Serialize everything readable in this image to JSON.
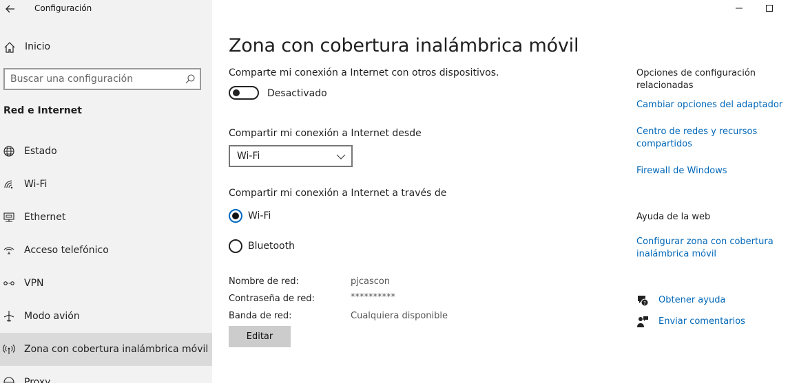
{
  "window": {
    "app_title": "Configuración"
  },
  "sidebar": {
    "home_label": "Inicio",
    "search_placeholder": "Buscar una configuración",
    "section_title": "Red e Internet",
    "items": [
      {
        "label": "Estado",
        "icon": "globe-icon",
        "selected": false
      },
      {
        "label": "Wi-Fi",
        "icon": "wifi-icon",
        "selected": false
      },
      {
        "label": "Ethernet",
        "icon": "ethernet-icon",
        "selected": false
      },
      {
        "label": "Acceso telefónico",
        "icon": "dialup-icon",
        "selected": false
      },
      {
        "label": "VPN",
        "icon": "vpn-icon",
        "selected": false
      },
      {
        "label": "Modo avión",
        "icon": "airplane-icon",
        "selected": false
      },
      {
        "label": "Zona con cobertura inalámbrica móvil",
        "icon": "hotspot-icon",
        "selected": true
      },
      {
        "label": "Proxy",
        "icon": "globe-icon",
        "selected": false
      }
    ]
  },
  "main": {
    "title": "Zona con cobertura inalámbrica móvil",
    "share_label": "Comparte mi conexión a Internet con otros dispositivos.",
    "toggle_state": "Desactivado",
    "share_from_label": "Compartir mi conexión a Internet desde",
    "share_from_value": "Wi-Fi",
    "share_via_label": "Compartir mi conexión a Internet a través de",
    "radio_wifi": "Wi-Fi",
    "radio_bluetooth": "Bluetooth",
    "selected_radio": "Wi-Fi",
    "network_name_label": "Nombre de red:",
    "network_name_value": "pjcascon",
    "password_label": "Contraseña de red:",
    "password_value": "**********",
    "band_label": "Banda de red:",
    "band_value": "Cualquiera disponible",
    "edit_button": "Editar"
  },
  "related": {
    "heading": "Opciones de configuración relacionadas",
    "link_adapter": "Cambiar opciones del adaptador",
    "link_network_center": "Centro de redes y recursos compartidos",
    "link_firewall": "Firewall de Windows",
    "web_help_heading": "Ayuda de la web",
    "link_configure_hotspot": "Configurar zona con cobertura inalámbrica móvil",
    "get_help": "Obtener ayuda",
    "send_feedback": "Enviar comentarios"
  },
  "colors": {
    "link": "#0067b8",
    "sidebar_bg": "#f2f2f2",
    "selected_bg": "#dadada",
    "button_bg": "#cccccc"
  }
}
